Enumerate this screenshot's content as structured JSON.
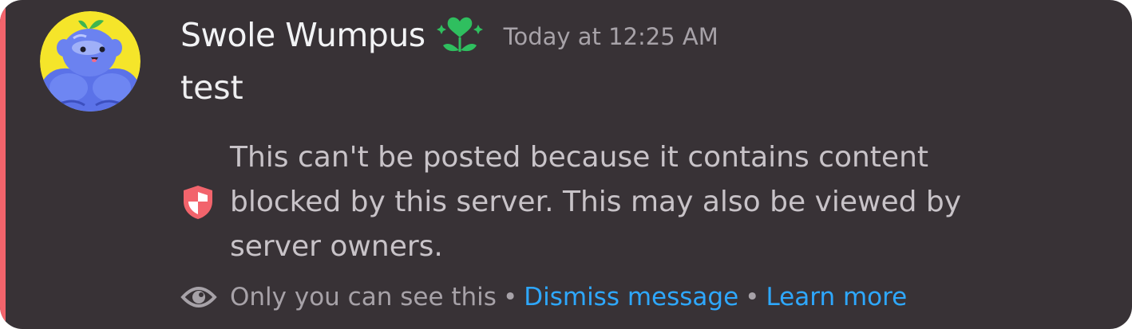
{
  "message": {
    "username": "Swole Wumpus",
    "timestamp": "Today at 12:25 AM",
    "text": "test",
    "role_icon": "heart-flower-icon"
  },
  "system_notice": {
    "icon": "shield-icon",
    "text": "This can't be posted because it contains content blocked by this server. This may also be viewed by server owners."
  },
  "footer": {
    "icon": "eye-icon",
    "visibility_text": "Only you can see this",
    "separator": "•",
    "dismiss_label": "Dismiss message",
    "learn_more_label": "Learn more"
  },
  "colors": {
    "background": "#383236",
    "accent_bar": "#f2646c",
    "link": "#2ea8ff",
    "role_icon": "#2fbf5f",
    "shield": "#f2646c"
  }
}
